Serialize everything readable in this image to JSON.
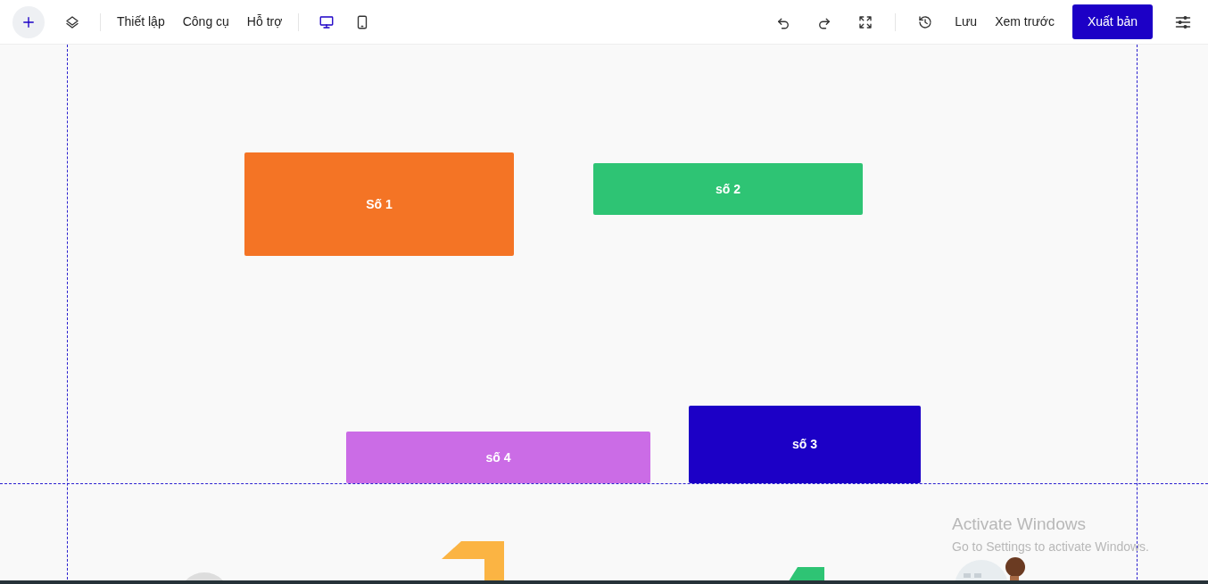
{
  "toolbar": {
    "left_menu": [
      {
        "label": "Thiết lập"
      },
      {
        "label": "Công cụ"
      },
      {
        "label": "Hỗ trợ"
      }
    ],
    "devices": [
      {
        "kind": "desktop",
        "selected": true
      },
      {
        "kind": "mobile",
        "selected": false
      }
    ],
    "right_links": [
      {
        "label": "Lưu"
      },
      {
        "label": "Xem trước"
      }
    ],
    "publish_button": "Xuất bản"
  },
  "canvas": {
    "blocks": [
      {
        "label": "Số 1",
        "color": "#f47425"
      },
      {
        "label": "số 2",
        "color": "#2ec474"
      },
      {
        "label": "số 4",
        "color": "#cb6ce6"
      },
      {
        "label": "số 3",
        "color": "#1c00c6"
      }
    ],
    "next_section": [
      {
        "kind": "picture"
      },
      {
        "kind": "shape",
        "color": "#fbb443"
      },
      {
        "kind": "shape",
        "color": "#2ec474"
      },
      {
        "kind": "picture"
      }
    ]
  },
  "os_notice": {
    "title": "Activate Windows",
    "text": "Go to Settings to activate Windows."
  }
}
